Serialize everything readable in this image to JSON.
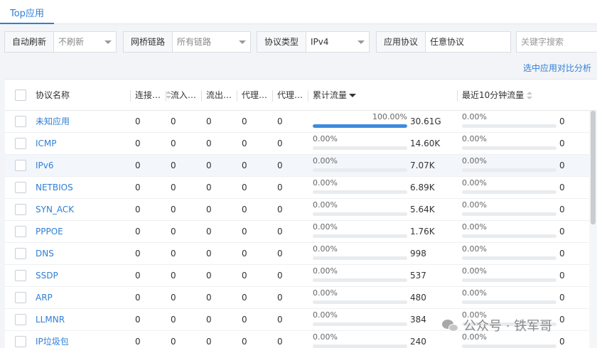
{
  "tabs": [
    {
      "label": "Top应用"
    }
  ],
  "filters": {
    "refresh": {
      "label": "自动刷新",
      "value": "不刷新"
    },
    "bridge": {
      "label": "网桥链路",
      "value": "所有链路"
    },
    "protocol_type": {
      "label": "协议类型",
      "value": "IPv4"
    },
    "app_protocol": {
      "label": "应用协议",
      "value": "任意协议"
    },
    "keyword": {
      "placeholder": "关键字搜索",
      "value": ""
    }
  },
  "compare_link": "选中应用对比分析",
  "table": {
    "columns": [
      "协议名称",
      "连接…",
      "流入…",
      "流出…",
      "代理…",
      "代理…",
      "累计流量",
      "最近10分钟流量"
    ],
    "sorted_column": "累计流量",
    "sort_direction": "descending",
    "rows": [
      {
        "name": "未知应用",
        "c1": "0",
        "c2": "0",
        "c3": "0",
        "c4": "0",
        "c5": "0",
        "total_pct": "100.00%",
        "total_fraction": 1.0,
        "total": "30.61G",
        "recent_pct": "0.00%",
        "recent_fraction": 0,
        "recent": "0"
      },
      {
        "name": "ICMP",
        "c1": "0",
        "c2": "0",
        "c3": "0",
        "c4": "0",
        "c5": "0",
        "total_pct": "0.00%",
        "total_fraction": 0,
        "total": "14.60K",
        "recent_pct": "0.00%",
        "recent_fraction": 0,
        "recent": "0"
      },
      {
        "name": "IPv6",
        "c1": "0",
        "c2": "0",
        "c3": "0",
        "c4": "0",
        "c5": "0",
        "total_pct": "0.00%",
        "total_fraction": 0,
        "total": "7.07K",
        "recent_pct": "0.00%",
        "recent_fraction": 0,
        "recent": "0"
      },
      {
        "name": "NETBIOS",
        "c1": "0",
        "c2": "0",
        "c3": "0",
        "c4": "0",
        "c5": "0",
        "total_pct": "0.00%",
        "total_fraction": 0,
        "total": "6.89K",
        "recent_pct": "0.00%",
        "recent_fraction": 0,
        "recent": "0"
      },
      {
        "name": "SYN_ACK",
        "c1": "0",
        "c2": "0",
        "c3": "0",
        "c4": "0",
        "c5": "0",
        "total_pct": "0.00%",
        "total_fraction": 0,
        "total": "5.64K",
        "recent_pct": "0.00%",
        "recent_fraction": 0,
        "recent": "0"
      },
      {
        "name": "PPPOE",
        "c1": "0",
        "c2": "0",
        "c3": "0",
        "c4": "0",
        "c5": "0",
        "total_pct": "0.00%",
        "total_fraction": 0,
        "total": "1.76K",
        "recent_pct": "0.00%",
        "recent_fraction": 0,
        "recent": "0"
      },
      {
        "name": "DNS",
        "c1": "0",
        "c2": "0",
        "c3": "0",
        "c4": "0",
        "c5": "0",
        "total_pct": "0.00%",
        "total_fraction": 0,
        "total": "998",
        "recent_pct": "0.00%",
        "recent_fraction": 0,
        "recent": "0"
      },
      {
        "name": "SSDP",
        "c1": "0",
        "c2": "0",
        "c3": "0",
        "c4": "0",
        "c5": "0",
        "total_pct": "0.00%",
        "total_fraction": 0,
        "total": "537",
        "recent_pct": "0.00%",
        "recent_fraction": 0,
        "recent": "0"
      },
      {
        "name": "ARP",
        "c1": "0",
        "c2": "0",
        "c3": "0",
        "c4": "0",
        "c5": "0",
        "total_pct": "0.00%",
        "total_fraction": 0,
        "total": "480",
        "recent_pct": "0.00%",
        "recent_fraction": 0,
        "recent": "0"
      },
      {
        "name": "LLMNR",
        "c1": "0",
        "c2": "0",
        "c3": "0",
        "c4": "0",
        "c5": "0",
        "total_pct": "0.00%",
        "total_fraction": 0,
        "total": "384",
        "recent_pct": "0.00%",
        "recent_fraction": 0,
        "recent": "0"
      },
      {
        "name": "IP垃圾包",
        "c1": "0",
        "c2": "0",
        "c3": "0",
        "c4": "0",
        "c5": "0",
        "total_pct": "0.00%",
        "total_fraction": 0,
        "total": "240",
        "recent_pct": "0.00%",
        "recent_fraction": 0,
        "recent": "0"
      }
    ]
  },
  "watermark": "公众号 · 铁军哥",
  "colors": {
    "accent": "#2f7fd6",
    "bar_fill": "#3d8bde",
    "bar_track": "#e9ecef"
  }
}
